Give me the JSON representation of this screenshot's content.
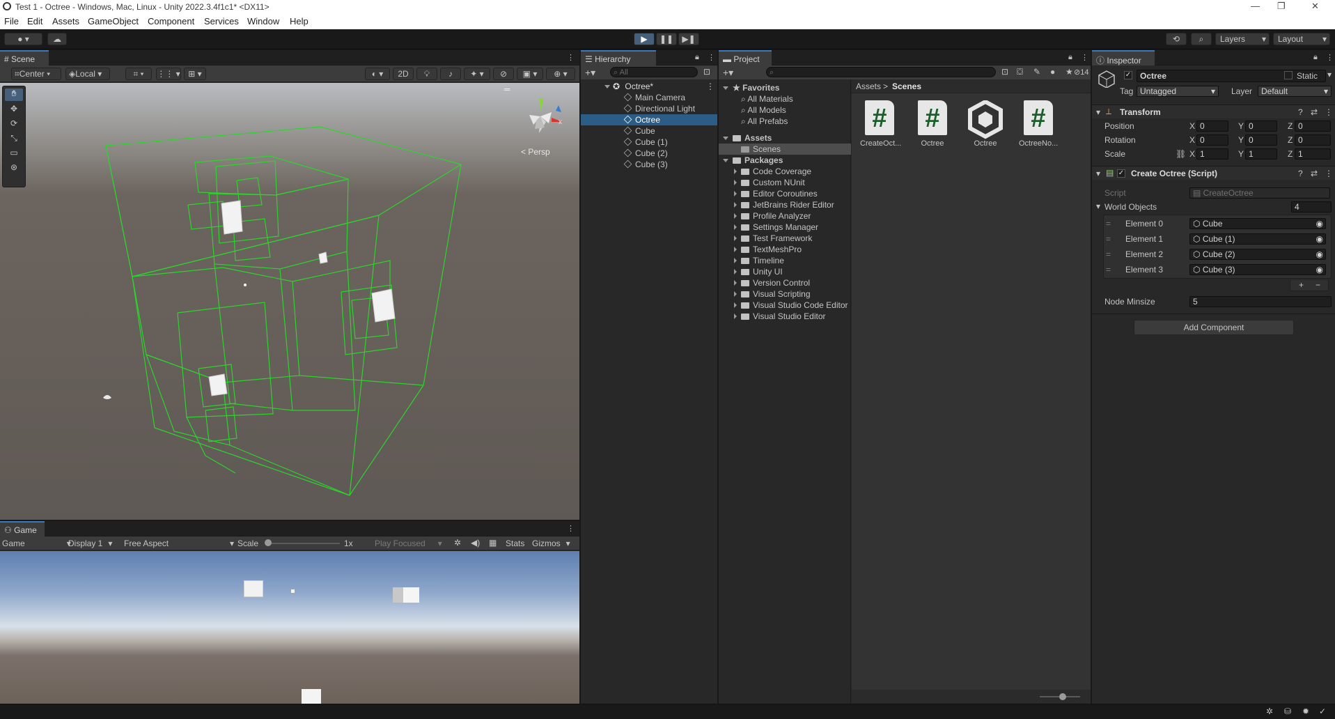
{
  "window": {
    "title": "Test 1 - Octree - Windows, Mac, Linux - Unity 2022.3.4f1c1* <DX11>",
    "controls": [
      "—",
      "❐",
      "✕"
    ]
  },
  "menu": [
    "File",
    "Edit",
    "Assets",
    "GameObject",
    "Component",
    "Services",
    "Window",
    "Help"
  ],
  "toolbar": {
    "layers_label": "Layers",
    "layout_label": "Layout"
  },
  "scene": {
    "tab_label": "Scene",
    "pivot_label": "Center",
    "space_label": "Local",
    "mode_2d": "2D",
    "persp_label": "Persp",
    "gizmo_x": "x",
    "gizmo_colors": {
      "wire": "#2dd42d",
      "x": "#d8352f",
      "y": "#8ad43a",
      "z": "#3a7ad8"
    }
  },
  "game": {
    "tab_label": "Game",
    "view_select": "Game",
    "display": "Display 1",
    "aspect": "Free Aspect",
    "scale_label": "Scale",
    "scale_value": "1x",
    "play_mode": "Play Focused",
    "stats": "Stats",
    "gizmos": "Gizmos"
  },
  "hierarchy": {
    "tab_label": "Hierarchy",
    "search_placeholder": "All",
    "scene_name": "Octree*",
    "items": [
      {
        "label": "Main Camera",
        "selected": false
      },
      {
        "label": "Directional Light",
        "selected": false
      },
      {
        "label": "Octree",
        "selected": true
      },
      {
        "label": "Cube",
        "selected": false
      },
      {
        "label": "Cube (1)",
        "selected": false
      },
      {
        "label": "Cube (2)",
        "selected": false
      },
      {
        "label": "Cube (3)",
        "selected": false
      }
    ]
  },
  "project": {
    "tab_label": "Project",
    "hidden_count": "14",
    "favorites_label": "Favorites",
    "favorites": [
      "All Materials",
      "All Models",
      "All Prefabs"
    ],
    "assets_label": "Assets",
    "assets_children": [
      "Scenes"
    ],
    "packages_label": "Packages",
    "packages": [
      "Code Coverage",
      "Custom NUnit",
      "Editor Coroutines",
      "JetBrains Rider Editor",
      "Profile Analyzer",
      "Settings Manager",
      "Test Framework",
      "TextMeshPro",
      "Timeline",
      "Unity UI",
      "Version Control",
      "Visual Scripting",
      "Visual Studio Code Editor",
      "Visual Studio Editor"
    ],
    "breadcrumb": [
      "Assets",
      "Scenes"
    ],
    "breadcrumb_sep": ">",
    "files": [
      {
        "name": "CreateOct...",
        "kind": "script"
      },
      {
        "name": "Octree",
        "kind": "script"
      },
      {
        "name": "Octree",
        "kind": "scene"
      },
      {
        "name": "OctreeNo...",
        "kind": "script"
      }
    ]
  },
  "inspector": {
    "tab_label": "Inspector",
    "object_name": "Octree",
    "static_label": "Static",
    "tag_label": "Tag",
    "tag_value": "Untagged",
    "layer_label": "Layer",
    "layer_value": "Default",
    "transform": {
      "title": "Transform",
      "rows": [
        {
          "label": "Position",
          "x": "0",
          "y": "0",
          "z": "0"
        },
        {
          "label": "Rotation",
          "x": "0",
          "y": "0",
          "z": "0"
        },
        {
          "label": "Scale",
          "x": "1",
          "y": "1",
          "z": "1"
        }
      ],
      "axis": [
        "X",
        "Y",
        "Z"
      ]
    },
    "script_component": {
      "title": "Create Octree (Script)",
      "script_label": "Script",
      "script_value": "CreateOctree",
      "world_objects_label": "World Objects",
      "world_objects_count": "4",
      "elements": [
        {
          "label": "Element 0",
          "value": "Cube"
        },
        {
          "label": "Element 1",
          "value": "Cube (1)"
        },
        {
          "label": "Element 2",
          "value": "Cube (2)"
        },
        {
          "label": "Element 3",
          "value": "Cube (3)"
        }
      ],
      "node_minsize_label": "Node Minsize",
      "node_minsize_value": "5"
    },
    "add_component": "Add Component"
  }
}
